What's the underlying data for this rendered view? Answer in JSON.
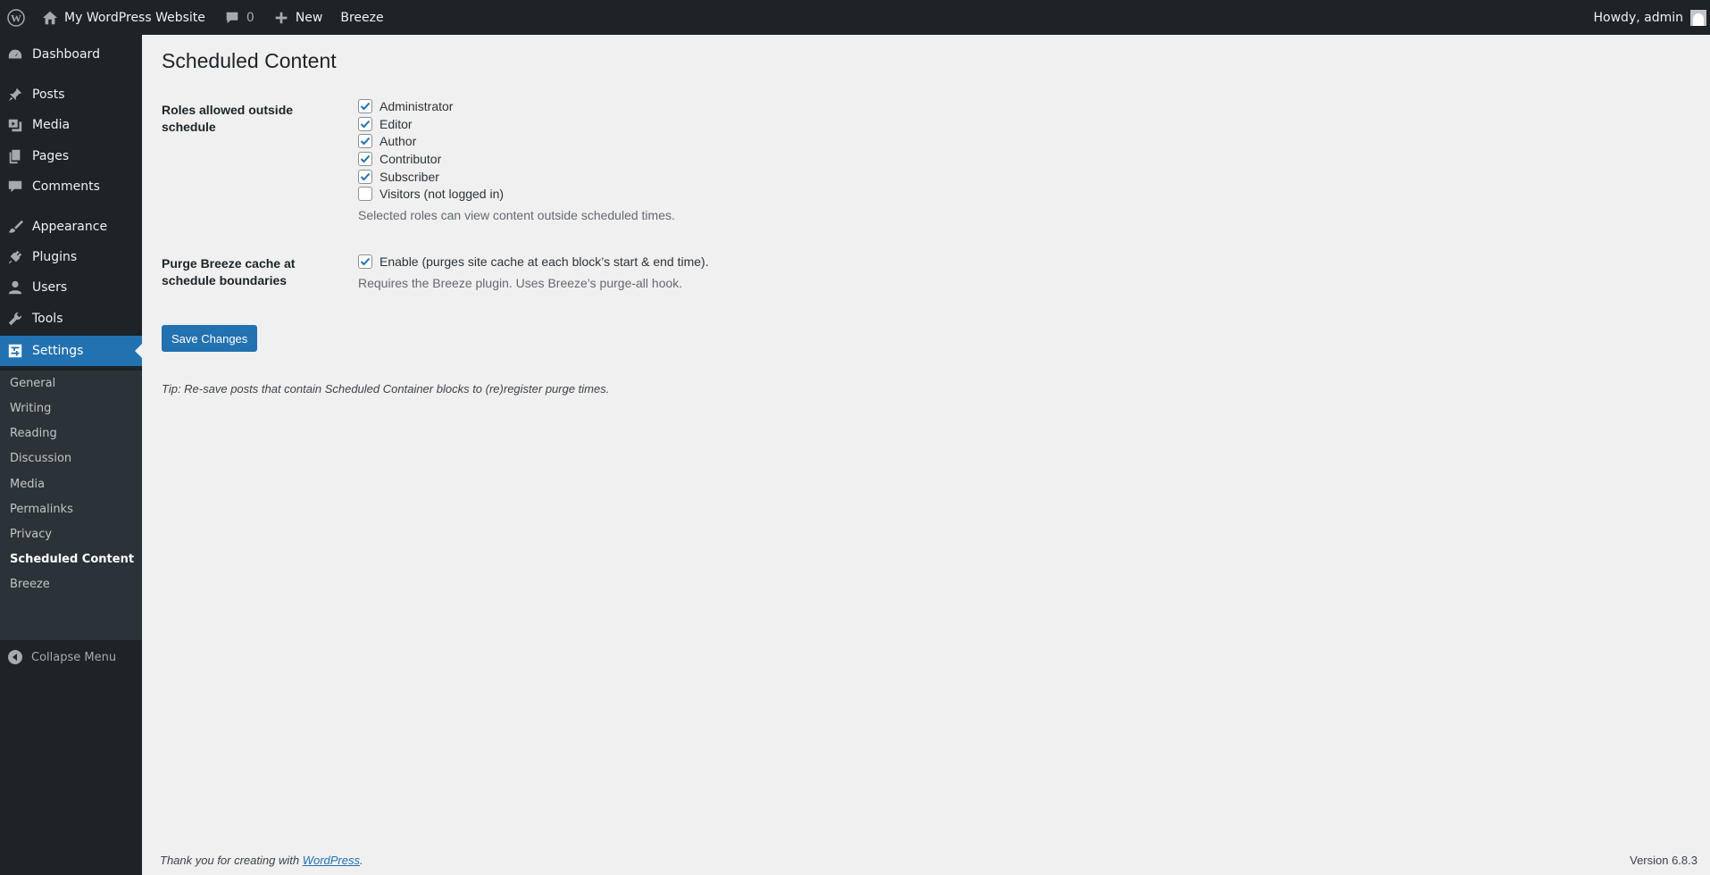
{
  "adminbar": {
    "site_name": "My WordPress Website",
    "comments_count": "0",
    "new_label": "New",
    "breeze_label": "Breeze",
    "howdy": "Howdy, admin"
  },
  "sidebar": {
    "items": [
      {
        "label": "Dashboard",
        "icon": "dashboard-icon"
      },
      {
        "label": "Posts",
        "icon": "pin-icon"
      },
      {
        "label": "Media",
        "icon": "media-icon"
      },
      {
        "label": "Pages",
        "icon": "pages-icon"
      },
      {
        "label": "Comments",
        "icon": "comment-icon"
      },
      {
        "label": "Appearance",
        "icon": "brush-icon"
      },
      {
        "label": "Plugins",
        "icon": "plug-icon"
      },
      {
        "label": "Users",
        "icon": "user-icon"
      },
      {
        "label": "Tools",
        "icon": "wrench-icon"
      },
      {
        "label": "Settings",
        "icon": "settings-icon"
      }
    ],
    "submenu": [
      "General",
      "Writing",
      "Reading",
      "Discussion",
      "Media",
      "Permalinks",
      "Privacy",
      "Scheduled Content",
      "Breeze"
    ],
    "current_submenu": "Scheduled Content",
    "collapse_label": "Collapse Menu"
  },
  "page": {
    "title": "Scheduled Content",
    "roles_label": "Roles allowed outside schedule",
    "roles": [
      {
        "label": "Administrator",
        "checked": true
      },
      {
        "label": "Editor",
        "checked": true
      },
      {
        "label": "Author",
        "checked": true
      },
      {
        "label": "Contributor",
        "checked": true
      },
      {
        "label": "Subscriber",
        "checked": true
      },
      {
        "label": "Visitors (not logged in)",
        "checked": false
      }
    ],
    "roles_description": "Selected roles can view content outside scheduled times.",
    "purge_label": "Purge Breeze cache at schedule boundaries",
    "purge_option": {
      "label": "Enable (purges site cache at each block’s start & end time).",
      "checked": true
    },
    "purge_description": "Requires the Breeze plugin. Uses Breeze’s purge-all hook.",
    "save_label": "Save Changes",
    "tip": "Tip: Re-save posts that contain Scheduled Container blocks to (re)register purge times."
  },
  "footer": {
    "thanks_prefix": "Thank you for creating with ",
    "thanks_link": "WordPress",
    "thanks_suffix": ".",
    "version": "Version 6.8.3"
  },
  "colors": {
    "accent": "#2271b1",
    "adminbar_bg": "#1d2327",
    "submenu_bg": "#2c3338",
    "content_bg": "#f0f0f1"
  }
}
